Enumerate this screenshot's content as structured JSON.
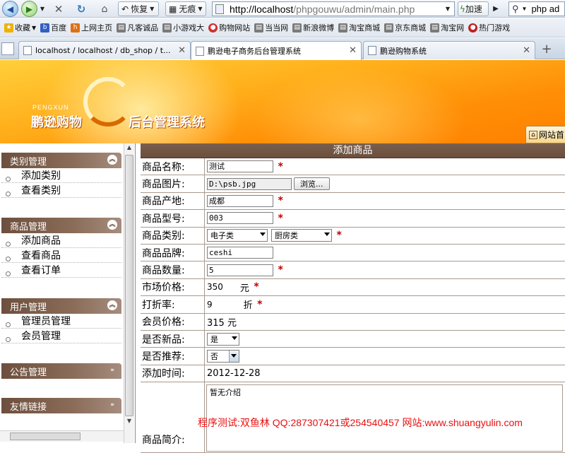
{
  "browser": {
    "back_icon": "arrow-left-icon",
    "forward_icon": "arrow-right-icon",
    "restore_label": "恢复",
    "incognito_label": "无痕",
    "url_host": "http://localhost",
    "url_path": "/phpgouwu/admin/main.php",
    "speedup_label": "加速",
    "search_value": "php ad"
  },
  "bookmarks": {
    "favorites_label": "收藏",
    "items": [
      "百度",
      "上网主页",
      "凡客诚品",
      "小游戏大",
      "购物网站",
      "当当网",
      "新浪微博",
      "淘宝商城",
      "京东商城",
      "淘宝网",
      "热门游戏"
    ]
  },
  "tabs": [
    {
      "label": "localhost / localhost / db_shop / t..."
    },
    {
      "label": "鹏逊电子商务后台管理系统"
    },
    {
      "label": "鹏逊购物系统"
    }
  ],
  "banner": {
    "logo_en": "PENGXUN",
    "logo_cn": "鹏逊购物",
    "system_title": "后台管理系统",
    "site_home_label": "网站首"
  },
  "sidebar": {
    "sections": [
      {
        "title": "类别管理",
        "items": [
          "添加类别",
          "查看类别"
        ]
      },
      {
        "title": "商品管理",
        "items": [
          "添加商品",
          "查看商品",
          "查看订单"
        ]
      },
      {
        "title": "用户管理",
        "items": [
          "管理员管理",
          "会员管理"
        ]
      },
      {
        "title": "公告管理",
        "items": []
      },
      {
        "title": "友情链接",
        "items": []
      }
    ]
  },
  "form": {
    "title": "添加商品",
    "name_label": "商品名称:",
    "name_value": "测试",
    "image_label": "商品图片:",
    "image_value": "D:\\psb.jpg",
    "browse_label": "浏览...",
    "origin_label": "商品产地:",
    "origin_value": "成都",
    "model_label": "商品型号:",
    "model_value": "003",
    "category_label": "商品类别:",
    "category_main": "电子类",
    "category_sub": "厨房类",
    "brand_label": "商品品牌:",
    "brand_value": "ceshi",
    "quantity_label": "商品数量:",
    "quantity_value": "5",
    "market_price_label": "市场价格:",
    "market_price_value": "350",
    "market_price_unit": "元",
    "discount_label": "打折率:",
    "discount_value": "9",
    "discount_unit": "折",
    "member_price_label": "会员价格:",
    "member_price_value": "315 元",
    "is_new_label": "是否新品:",
    "is_new_value": "是",
    "is_recommended_label": "是否推荐:",
    "is_recommended_value": "否",
    "add_time_label": "添加时间:",
    "add_time_value": "2012-12-28",
    "intro_label": "商品简介:",
    "intro_value": "暂无介绍",
    "required_mark": "*"
  },
  "watermark": "程序测试:双鱼林 QQ:287307421或254540457 网站:www.shuangyulin.com",
  "colors": {
    "banner": "#ff9a10",
    "sidebar_header": "#6d4f3d",
    "required": "#c00000",
    "watermark": "#e81010"
  }
}
